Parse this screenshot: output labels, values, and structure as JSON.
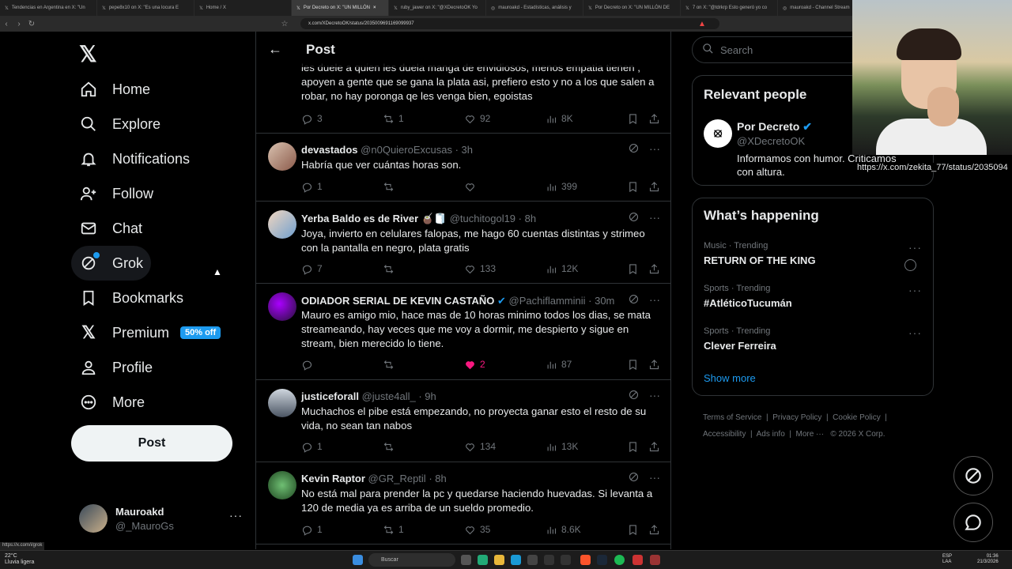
{
  "browser": {
    "tabs": [
      "Tendencias en Argentina en X: \"Un",
      "pepe8x10 on X: \"Es una locura E",
      "Home / X",
      "Por Decreto on X: \"UN MILLÓN",
      "ruby_jawer on X: \"@XDecretoOK Yo",
      "mauroakd - Estadísticas, análisis y",
      "Por Decreto on X: \"UN MILLÓN DE",
      "7 on X: \"@tdrkrp Esto generó yo co",
      "mauroakd - Channel Stream"
    ],
    "active_tab_index": 3,
    "url": "x.com/XDecretoOK/status/2035009691169099937",
    "status_hint": "https://x.com/i/grok"
  },
  "sidebar": {
    "items": [
      {
        "label": "Home",
        "icon": "home-icon"
      },
      {
        "label": "Explore",
        "icon": "search-icon"
      },
      {
        "label": "Notifications",
        "icon": "bell-icon"
      },
      {
        "label": "Follow",
        "icon": "person-plus-icon"
      },
      {
        "label": "Chat",
        "icon": "mail-icon"
      },
      {
        "label": "Grok",
        "icon": "grok-icon"
      },
      {
        "label": "Bookmarks",
        "icon": "bookmark-icon"
      },
      {
        "label": "Premium",
        "icon": "x-logo-icon",
        "badge": "50% off"
      },
      {
        "label": "Profile",
        "icon": "person-icon"
      },
      {
        "label": "More",
        "icon": "more-circle-icon"
      }
    ],
    "post_button": "Post",
    "account": {
      "name": "Mauroakd",
      "handle": "@_MauroGs"
    }
  },
  "main": {
    "title": "Post",
    "top_fragment": {
      "text": "les duele a quien les duela manga de envidiosos, menos empatia tienen , apoyen a gente que se gana la plata asi, prefiero esto y no a los que salen a robar, no hay poronga qe les venga bien, egoistas",
      "replies": "3",
      "reposts": "1",
      "likes": "92",
      "views": "8K"
    },
    "replies": [
      {
        "name": "devastados",
        "handle": "@n0QuieroExcusas",
        "time": "· 3h",
        "text": "Habría que ver cuántas horas son.",
        "replies": "1",
        "reposts": "",
        "likes": "",
        "views": "399"
      },
      {
        "name": "Yerba Baldo es de River 🧉🧻",
        "handle": "@tuchitogol19",
        "time": "· 8h",
        "text": "Joya, invierto en celulares falopas, me hago 60 cuentas distintas y strimeo con la pantalla en negro, plata gratis",
        "replies": "7",
        "reposts": "",
        "likes": "133",
        "views": "12K"
      },
      {
        "name": "ODIADOR SERIAL DE KEVIN CASTAÑO",
        "handle": "@Pachiflamminii",
        "time": "· 30m",
        "text": "Mauro es amigo mio, hace mas de 10 horas minimo todos los dias, se mata streameando, hay veces que me voy a dormir, me despierto y sigue en stream, bien merecido lo tiene.",
        "replies": "",
        "reposts": "",
        "likes": "2",
        "views": "87"
      },
      {
        "name": "justiceforall",
        "handle": "@juste4all_",
        "time": "· 9h",
        "text": "Muchachos el pibe está empezando, no proyecta ganar esto el resto de su vida, no sean tan nabos",
        "replies": "1",
        "reposts": "",
        "likes": "134",
        "views": "13K"
      },
      {
        "name": "Kevin Raptor",
        "handle": "@GR_Reptil",
        "time": "· 8h",
        "text": "No está mal para prender la pc y quedarse haciendo huevadas. Si levanta a 120 de media ya es arriba de un sueldo promedio.",
        "replies": "1",
        "reposts": "1",
        "likes": "35",
        "views": "8.6K"
      }
    ]
  },
  "right": {
    "search_placeholder": "Search",
    "relevant_title": "Relevant people",
    "person": {
      "name": "Por Decreto",
      "handle": "@XDecretoOK",
      "bio": "Informamos con humor. Criticamos",
      "bio2": "con altura."
    },
    "happening_title": "What’s happening",
    "trends": [
      {
        "category": "Music · Trending",
        "name": "RETURN OF THE KING"
      },
      {
        "category": "Sports · Trending",
        "name": "#AtléticoTucumán"
      },
      {
        "category": "Sports · Trending",
        "name": "Clever Ferreira"
      }
    ],
    "show_more": "Show more",
    "footer": [
      "Terms of Service",
      "Privacy Policy",
      "Cookie Policy",
      "Accessibility",
      "Ads info",
      "More ···",
      "© 2026 X Corp."
    ]
  },
  "overlay": {
    "link_tooltip": "https://x.com/zekita_77/status/2035094"
  },
  "taskbar": {
    "weather_temp": "22°C",
    "weather_desc": "Lluvia ligera",
    "search": "Buscar",
    "lang": "ESP",
    "lang2": "LAA",
    "time": "01:36",
    "date": "21/3/2026"
  },
  "colors": {
    "accent": "#1d9bf0",
    "like_active": "#f91880",
    "border": "#2f3336",
    "muted": "#71767b"
  }
}
